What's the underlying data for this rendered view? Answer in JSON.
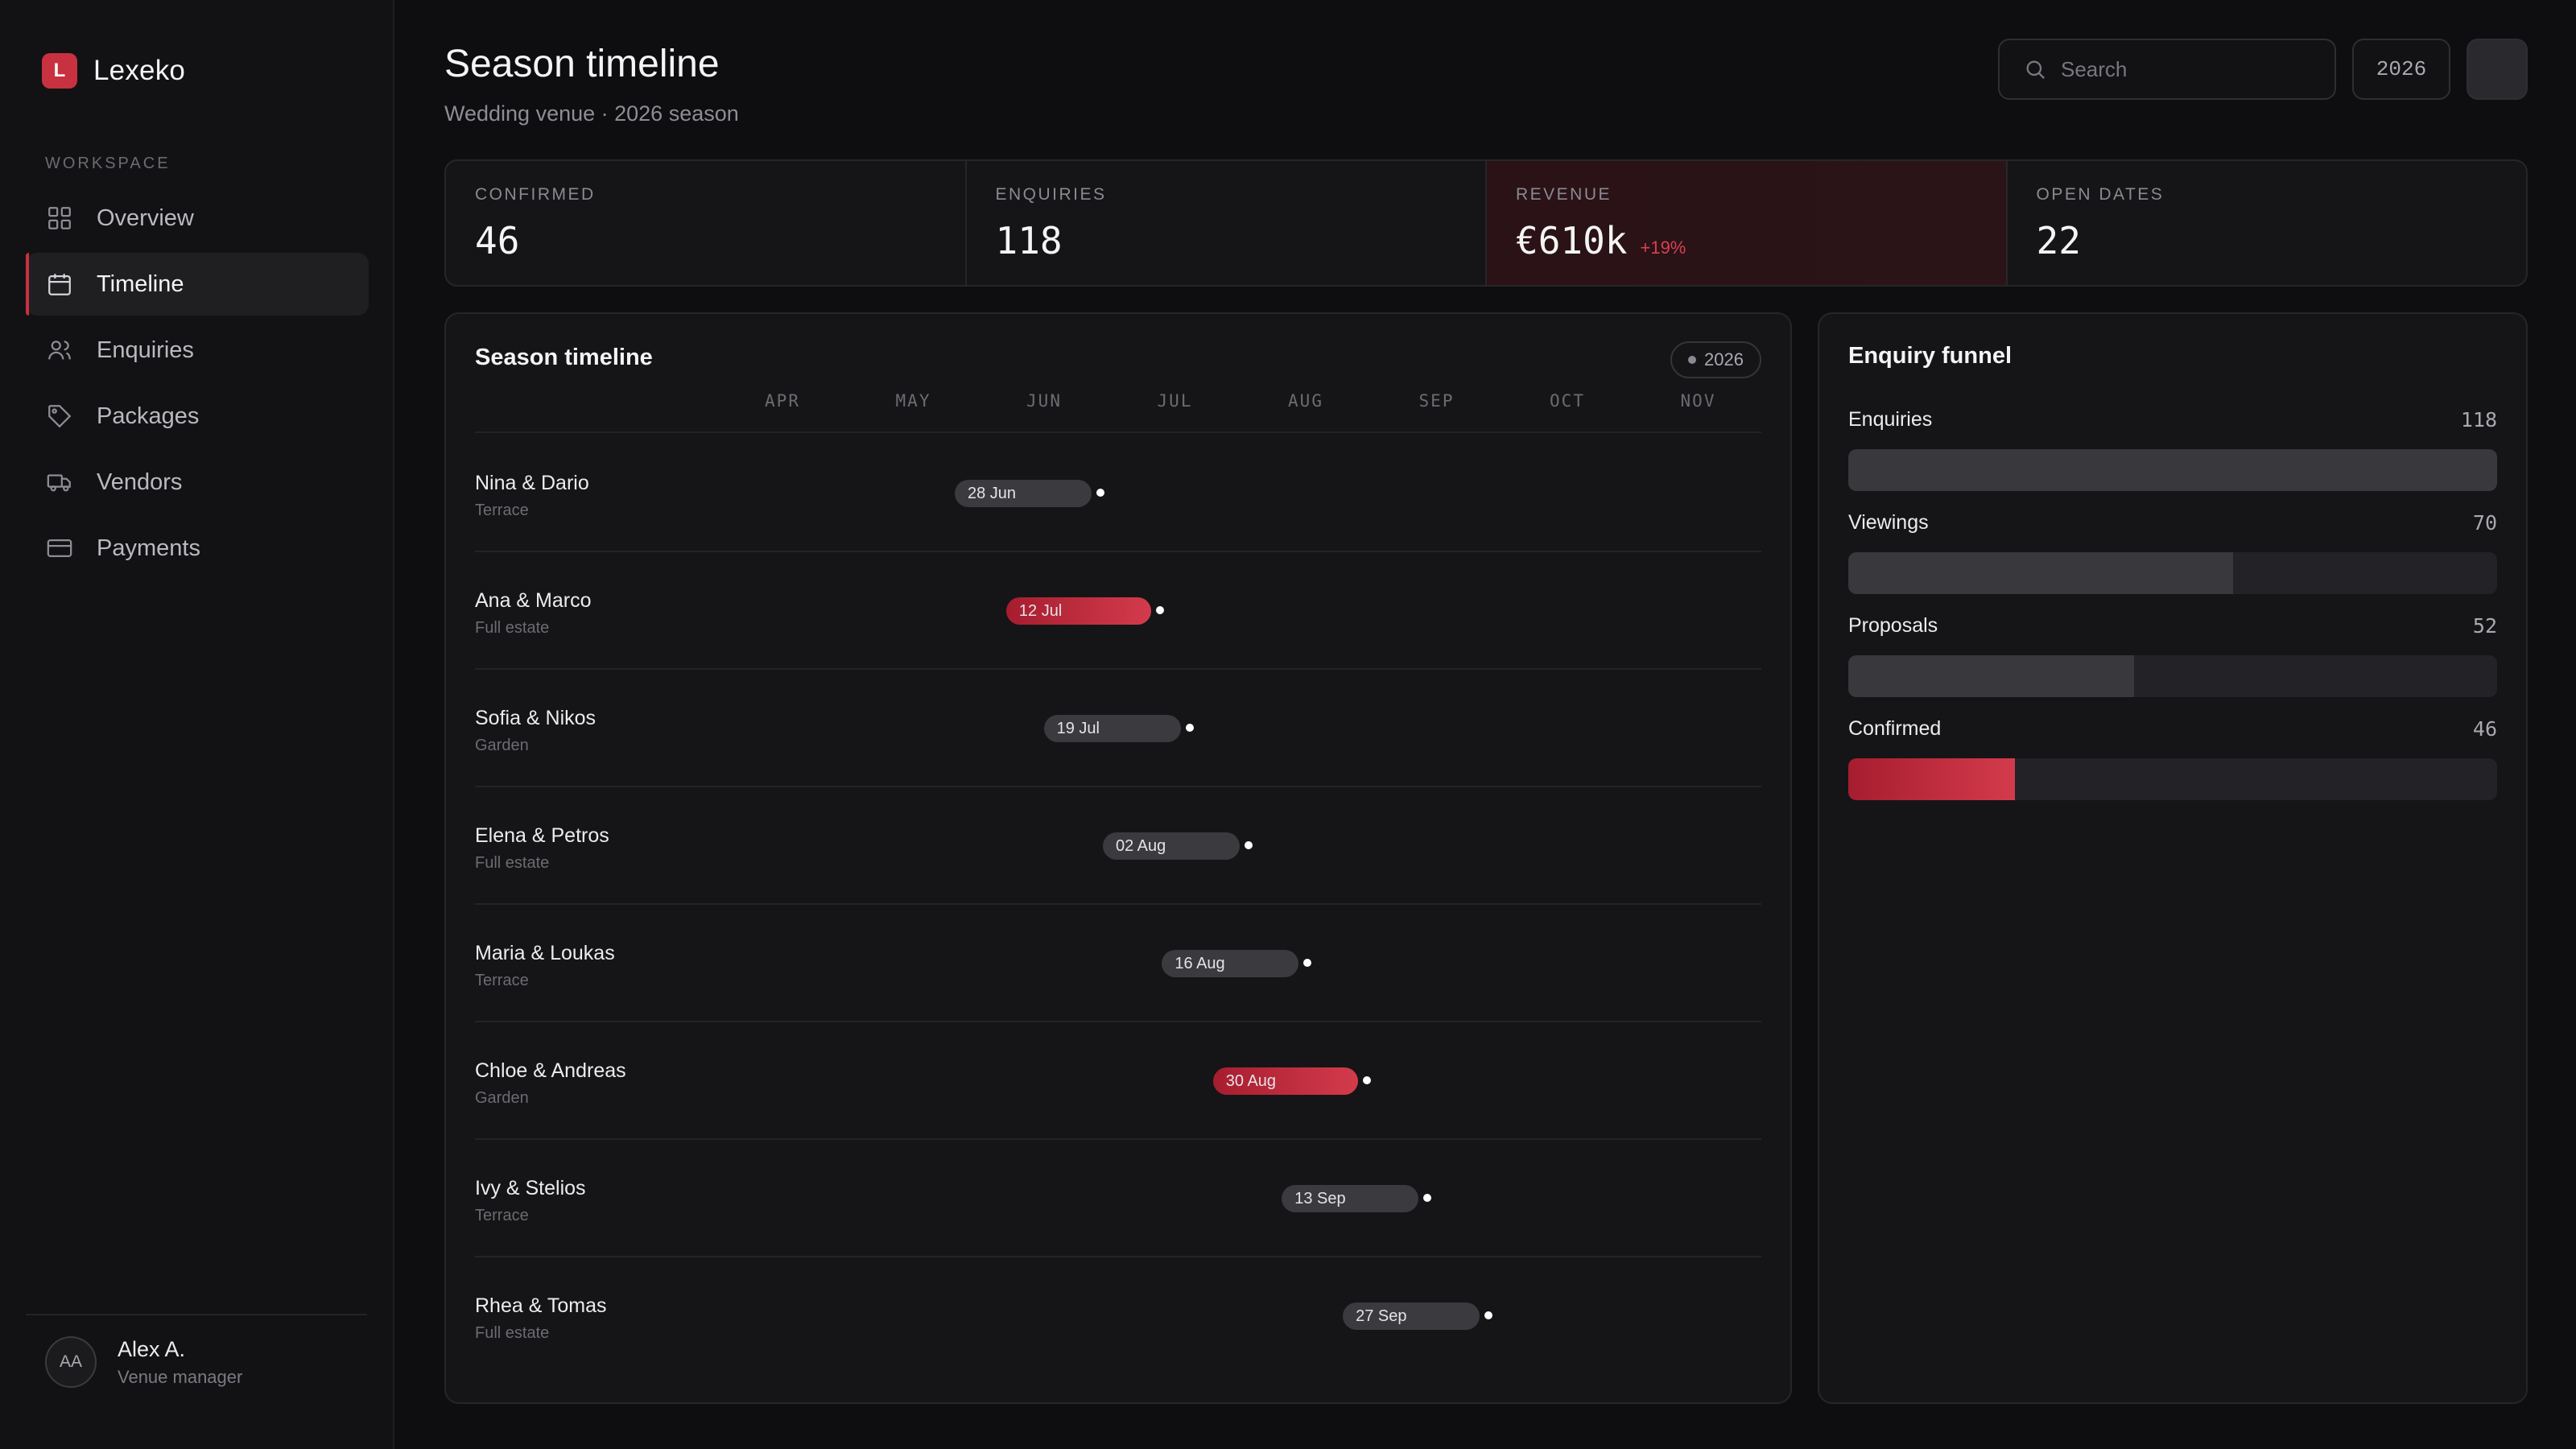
{
  "brand": {
    "initial": "L",
    "name": "Lexeko"
  },
  "sidebar": {
    "section_label": "WORKSPACE",
    "items": [
      {
        "label": "Overview",
        "icon": "grid-icon",
        "active": false
      },
      {
        "label": "Timeline",
        "icon": "calendar-icon",
        "active": true
      },
      {
        "label": "Enquiries",
        "icon": "users-icon",
        "active": false
      },
      {
        "label": "Packages",
        "icon": "tag-icon",
        "active": false
      },
      {
        "label": "Vendors",
        "icon": "truck-icon",
        "active": false
      },
      {
        "label": "Payments",
        "icon": "credit-card-icon",
        "active": false
      }
    ],
    "user": {
      "initials": "AA",
      "name": "Alex A.",
      "role": "Venue manager"
    }
  },
  "header": {
    "title": "Season timeline",
    "subtitle": "Wedding venue · 2026 season",
    "search_placeholder": "Search",
    "year": "2026"
  },
  "stats": [
    {
      "label": "CONFIRMED",
      "value": "46",
      "delta": "",
      "highlight": false
    },
    {
      "label": "ENQUIRIES",
      "value": "118",
      "delta": "",
      "highlight": false
    },
    {
      "label": "REVENUE",
      "value": "€610k",
      "delta": "+19%",
      "highlight": true
    },
    {
      "label": "OPEN DATES",
      "value": "22",
      "delta": "",
      "highlight": false
    }
  ],
  "timeline": {
    "title": "Season timeline",
    "year_pill": "2026",
    "months": [
      "APR",
      "MAY",
      "JUN",
      "JUL",
      "AUG",
      "SEP",
      "OCT",
      "NOV"
    ],
    "bookings": [
      {
        "couple": "Nina & Dario",
        "venue": "Terrace",
        "date_label": "28 Jun",
        "date": "2026-06-28",
        "highlight": false
      },
      {
        "couple": "Ana & Marco",
        "venue": "Full estate",
        "date_label": "12 Jul",
        "date": "2026-07-12",
        "highlight": true
      },
      {
        "couple": "Sofia & Nikos",
        "venue": "Garden",
        "date_label": "19 Jul",
        "date": "2026-07-19",
        "highlight": false
      },
      {
        "couple": "Elena & Petros",
        "venue": "Full estate",
        "date_label": "02 Aug",
        "date": "2026-08-02",
        "highlight": false
      },
      {
        "couple": "Maria & Loukas",
        "venue": "Terrace",
        "date_label": "16 Aug",
        "date": "2026-08-16",
        "highlight": false
      },
      {
        "couple": "Chloe & Andreas",
        "venue": "Garden",
        "date_label": "30 Aug",
        "date": "2026-08-30",
        "highlight": true
      },
      {
        "couple": "Ivy & Stelios",
        "venue": "Terrace",
        "date_label": "13 Sep",
        "date": "2026-09-13",
        "highlight": false
      },
      {
        "couple": "Rhea & Tomas",
        "venue": "Full estate",
        "date_label": "27 Sep",
        "date": "2026-09-27",
        "highlight": false
      }
    ]
  },
  "funnel": {
    "title": "Enquiry funnel",
    "stages": [
      {
        "label": "Enquiries",
        "count": 118,
        "highlight": false
      },
      {
        "label": "Viewings",
        "count": 70,
        "highlight": false
      },
      {
        "label": "Proposals",
        "count": 52,
        "highlight": false
      },
      {
        "label": "Confirmed",
        "count": 46,
        "highlight": true
      }
    ]
  },
  "colors": {
    "accent": "#c8313f",
    "background": "#0e0e10",
    "card": "#151517"
  }
}
